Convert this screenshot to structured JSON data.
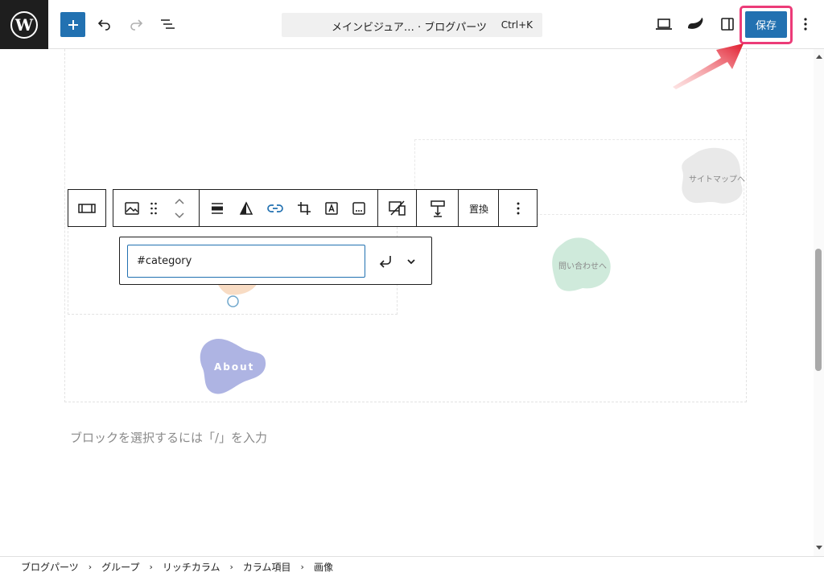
{
  "header": {
    "document_title": "メインビジュア… · ブログパーツ",
    "command_shortcut": "Ctrl+K",
    "save_label": "保存"
  },
  "image_block": {
    "about_label": "About",
    "sitemap_label": "サイトマップへ",
    "contact_label": "問い合わせへ"
  },
  "block_toolbar": {
    "replace_label": "置換"
  },
  "link_popover": {
    "url_value": "#category"
  },
  "editor": {
    "placeholder": "ブロックを選択するには「/」を入力"
  },
  "breadcrumb": {
    "items": [
      "ブログパーツ",
      "グループ",
      "リッチカラム",
      "カラム項目",
      "画像"
    ]
  },
  "colors": {
    "accent": "#2271b1",
    "highlight": "#ec3b78",
    "about_blob": "#aeb4e3",
    "contact_blob": "#cfeadb",
    "sitemap_blob": "#e9e9e9"
  }
}
